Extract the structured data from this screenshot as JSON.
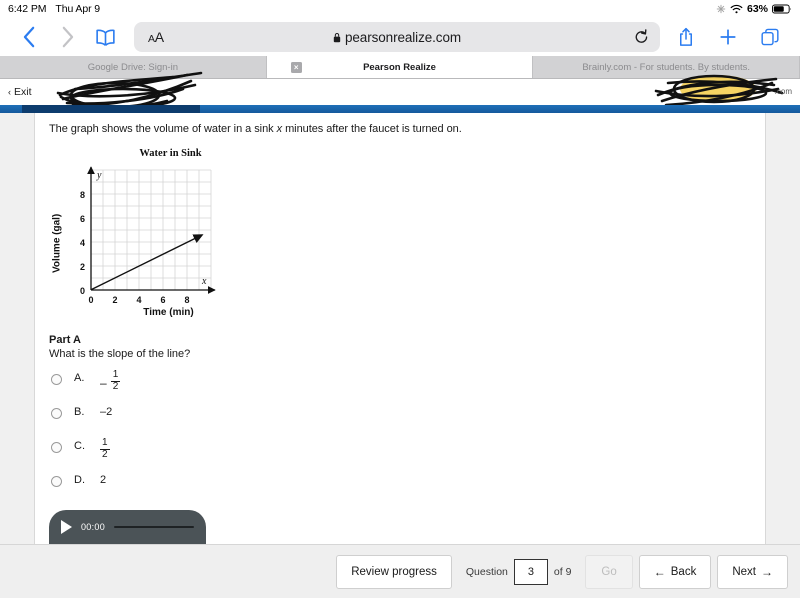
{
  "status_bar": {
    "time": "6:42 PM",
    "date": "Thu Apr 9",
    "battery_percent": "63%",
    "icons": [
      "sparkle-icon",
      "wifi-icon",
      "battery-icon"
    ]
  },
  "browser": {
    "back_label": "back-chevron-icon",
    "forward_label": "forward-chevron-icon",
    "bookmarks_label": "book-icon",
    "text_size_label": "AA",
    "url": "pearsonrealize.com",
    "url_secure": true,
    "reload_label": "reload-icon",
    "share_label": "share-icon",
    "new_tab_label": "plus-icon",
    "tabs_label": "tabs-icon",
    "tabs": [
      {
        "title": "Google Drive: Sign-in",
        "active": false,
        "closable": false
      },
      {
        "title": "Pearson Realize",
        "active": true,
        "closable": true,
        "close_label": "×"
      },
      {
        "title": "Brainly.com - For students. By students.",
        "active": false,
        "closable": false
      }
    ]
  },
  "app_header": {
    "exit_label": "Exit",
    "exit_chevron": "‹",
    "redacted_right_fragment": ".com",
    "accent_blue": "#1b6cb5",
    "accent_navy": "#0d3c6e"
  },
  "assessment": {
    "prompt_before": "The graph shows the volume of water in a sink ",
    "prompt_italic": "x",
    "prompt_after": " minutes after the faucet is turned on.",
    "part_label": "Part A",
    "question": "What is the slope of the line?",
    "choices": [
      {
        "letter": "A.",
        "value": "-1/2",
        "display": {
          "sign": "–",
          "num": "1",
          "den": "2"
        },
        "selected": false
      },
      {
        "letter": "B.",
        "value": "-2",
        "display": {
          "plain": "–2"
        },
        "selected": false
      },
      {
        "letter": "C.",
        "value": "1/2",
        "display": {
          "num": "1",
          "den": "2"
        },
        "selected": false
      },
      {
        "letter": "D.",
        "value": "2",
        "display": {
          "plain": "2"
        },
        "selected": false
      }
    ]
  },
  "chart_data": {
    "type": "line",
    "title": "Water in Sink",
    "xlabel": "Time (min)",
    "ylabel": "Volume (gal)",
    "xlim": [
      0,
      10
    ],
    "ylim": [
      0,
      10
    ],
    "xticks": [
      0,
      2,
      4,
      6,
      8
    ],
    "yticks": [
      0,
      2,
      4,
      6,
      8
    ],
    "xticklabels": [
      "0",
      "2",
      "4",
      "6",
      "8"
    ],
    "yticklabels": [
      "0",
      "2",
      "4",
      "6",
      "8"
    ],
    "axis_name_x": "x",
    "axis_name_y": "y",
    "grid": true,
    "grid_step": 1,
    "series": [
      {
        "name": "volume",
        "slope": 0.5,
        "intercept": 0,
        "points": [
          [
            0,
            0
          ],
          [
            9.4,
            4.7
          ]
        ],
        "arrow_end": true,
        "color": "#1a1a1a"
      }
    ]
  },
  "audio": {
    "play_label": "play-icon",
    "time": "00:00",
    "progress_percent": 0
  },
  "bottom_toolbar": {
    "review_label": "Review progress",
    "question_prefix": "Question",
    "question_number": "3",
    "question_suffix": "of 9",
    "go_label": "Go",
    "go_disabled": true,
    "back_label": "Back",
    "back_arrow": "←",
    "next_label": "Next",
    "next_arrow": "→"
  }
}
